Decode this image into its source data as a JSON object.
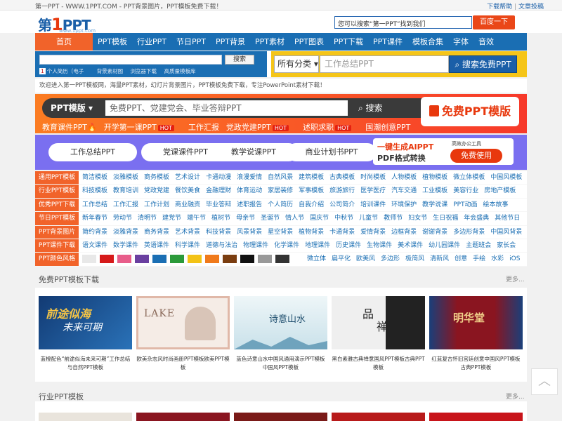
{
  "topbar": {
    "left": "第一PPT - WWW.1PPT.COM - PPT背景图片，PPT模板免费下载！",
    "help": "下载帮助",
    "sep": "|",
    "submit": "文章投稿"
  },
  "logo": {
    "text1": "第",
    "text2": "1",
    "text3": "PPT",
    "sub": "www.1ppt.com"
  },
  "search": {
    "placeholder": "您可以搜索“第一PPT”找到我们",
    "button": "百度一下"
  },
  "nav": [
    "首页",
    "PPT模板",
    "行业PPT",
    "节日PPT",
    "PPT背景",
    "PPT素材",
    "PPT图表",
    "PPT下载",
    "PPT课件",
    "模板合集",
    "字体",
    "音效"
  ],
  "bluebox": {
    "button": "搜索",
    "links": [
      {
        "tag": "1",
        "label": "个人简历（电子"
      },
      {
        "label": "背景素材图"
      },
      {
        "label": "浏览器下载"
      },
      {
        "label": "高质量模板库"
      }
    ]
  },
  "yellowbox": {
    "select": "所有分类 ▾",
    "placeholder": "工作总结PPT",
    "button": "搜索免费PPT"
  },
  "welcome": "欢迎进入第一PPT模板网，海量PPT素材，幻灯片背景图片，PPT模板免费下载，专注PowerPoint素材下载！",
  "banner1": {
    "category": "PPT模版 ▾",
    "placeholder": "免费PPT、党建党会、毕业答辩PPT",
    "button": "搜索",
    "right": "免费PPT模版",
    "tags": [
      {
        "label": "教育课件PPT🔥",
        "hot": ""
      },
      {
        "label": "开学第一课PPT",
        "hot": "HOT"
      },
      {
        "label": "工作汇报",
        "hot": ""
      },
      {
        "label": "党政党建PPT",
        "hot": "HOT"
      },
      {
        "label": "述职求职",
        "hot": "HOT"
      },
      {
        "label": "国潮创意PPT",
        "hot": ""
      }
    ]
  },
  "banner2": {
    "pills": [
      "工作总结PPT",
      "党课课件PPT",
      "教学说课PPT",
      "商业计划书PPT"
    ],
    "right_t1": "一键生成AIPPT",
    "right_t2": "PDF格式转换",
    "right_t3": "高效办公工具",
    "right_btn": "免费使用"
  },
  "categories": [
    {
      "label": "通用PPT模板",
      "links": [
        "简洁模板",
        "淡雅模板",
        "商务模板",
        "艺术设计",
        "卡通动漫",
        "浪漫爱情",
        "自然风景",
        "建筑模板",
        "古典模板",
        "时尚模板",
        "人物模板",
        "植物模板",
        "微立体模板",
        "中国风模板"
      ]
    },
    {
      "label": "行业PPT模板",
      "links": [
        "科技模板",
        "教育培训",
        "党政党建",
        "餐饮美食",
        "金融理财",
        "体育运动",
        "家居装修",
        "军事模板",
        "旅游旅行",
        "医学医疗",
        "汽车交通",
        "工业模板",
        "美容行业",
        "房地产模板"
      ]
    },
    {
      "label": "优秀PPT下载",
      "links": [
        "工作总结",
        "工作汇报",
        "工作计划",
        "商业融资",
        "毕业答辩",
        "述职报告",
        "个人简历",
        "自我介绍",
        "公司简介",
        "培训课件",
        "环境保护",
        "教学说课",
        "PPT动画",
        "绘本故事"
      ]
    },
    {
      "label": "节日PPT模板",
      "links": [
        "新年春节",
        "劳动节",
        "清明节",
        "建党节",
        "端午节",
        "植树节",
        "母亲节",
        "圣诞节",
        "情人节",
        "国庆节",
        "中秋节",
        "儿童节",
        "教师节",
        "妇女节",
        "生日祝福",
        "年会盛典",
        "其他节日"
      ]
    },
    {
      "label": "PPT背景图片",
      "links": [
        "简约背景",
        "淡雅背景",
        "商务背景",
        "艺术背景",
        "科技背景",
        "风景背景",
        "星空背景",
        "植物背景",
        "卡通背景",
        "爱情背景",
        "边框背景",
        "谢谢背景",
        "多边形背景",
        "中国风背景"
      ]
    },
    {
      "label": "PPT课件下载",
      "links": [
        "语文课件",
        "数学课件",
        "英语课件",
        "科学课件",
        "道德与法治",
        "物理课件",
        "化学课件",
        "地理课件",
        "历史课件",
        "生物课件",
        "美术课件",
        "幼儿园课件",
        "主题班会",
        "家长会"
      ]
    },
    {
      "label": "PPT颜色风格",
      "links": [
        "微立体",
        "扁平化",
        "欧美风",
        "多边形",
        "极简风",
        "清新风",
        "创意",
        "手绘",
        "水彩",
        "iOS"
      ]
    }
  ],
  "colors": [
    "#e8e8e8",
    "#d61a1a",
    "#e85d8a",
    "#6a3fa0",
    "#1a6eb3",
    "#2b9a3a",
    "#f3c316",
    "#f07a1b",
    "#7a3d10",
    "#111111",
    "#999999",
    "#333333"
  ],
  "section1": {
    "title": "免费PPT模板下载",
    "more": "更多..."
  },
  "cards": [
    {
      "caption": "蓝橙配色“前途似海未来可期”工作总结与自然PPT模板",
      "bg": "#1b4a8a"
    },
    {
      "caption": "欧美杂志风时尚画册PPT模板欧美PPT模板",
      "bg": "#f0e6e0"
    },
    {
      "caption": "蓝色诗意山水中国风通用演示PPT模板中国风PPT模板",
      "bg": "#dfeef4"
    },
    {
      "caption": "黑白素雅古典禅意国风PPT模板古典PPT模板",
      "bg": "#e9e9e9"
    },
    {
      "caption": "红蓝复古怀旧宫廷创意中国风PPT模板古典PPT模板",
      "bg": "#8a1520"
    }
  ],
  "card_titles": {
    "c1a": "前途似海",
    "c1b": "未来可期",
    "c2": "LAKE",
    "c3": "诗意山水",
    "c4a": "品",
    "c4b": "禅",
    "c5": "明华堂"
  },
  "section2": {
    "title": "行业PPT模板",
    "more": "更多..."
  },
  "backtop": "︿"
}
